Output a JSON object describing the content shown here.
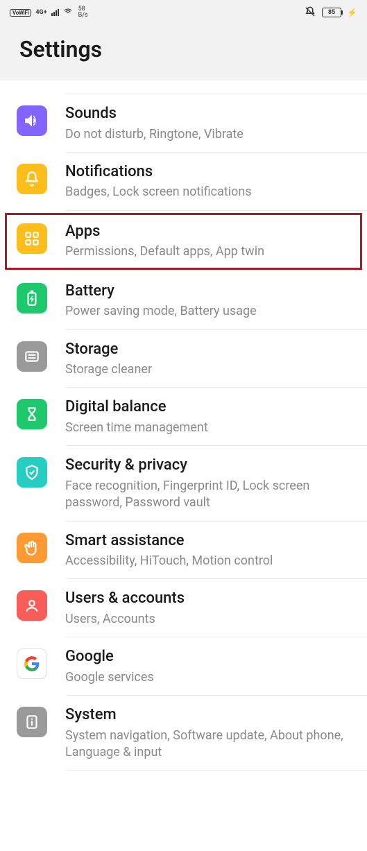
{
  "status": {
    "vowifi": "VoWiFi",
    "net_gen": "4G+",
    "speed_value": "58",
    "speed_unit": "B/s",
    "battery": "85"
  },
  "header": {
    "title": "Settings"
  },
  "items": [
    {
      "title": "Sounds",
      "subtitle": "Do not disturb, Ringtone, Vibrate"
    },
    {
      "title": "Notifications",
      "subtitle": "Badges, Lock screen notifications"
    },
    {
      "title": "Apps",
      "subtitle": "Permissions, Default apps, App twin"
    },
    {
      "title": "Battery",
      "subtitle": "Power saving mode, Battery usage"
    },
    {
      "title": "Storage",
      "subtitle": "Storage cleaner"
    },
    {
      "title": "Digital balance",
      "subtitle": "Screen time management"
    },
    {
      "title": "Security & privacy",
      "subtitle": "Face recognition, Fingerprint ID, Lock screen password, Password vault"
    },
    {
      "title": "Smart assistance",
      "subtitle": "Accessibility, HiTouch, Motion control"
    },
    {
      "title": "Users & accounts",
      "subtitle": "Users, Accounts"
    },
    {
      "title": "Google",
      "subtitle": "Google services"
    },
    {
      "title": "System",
      "subtitle": "System navigation, Software update, About phone, Language & input"
    }
  ]
}
